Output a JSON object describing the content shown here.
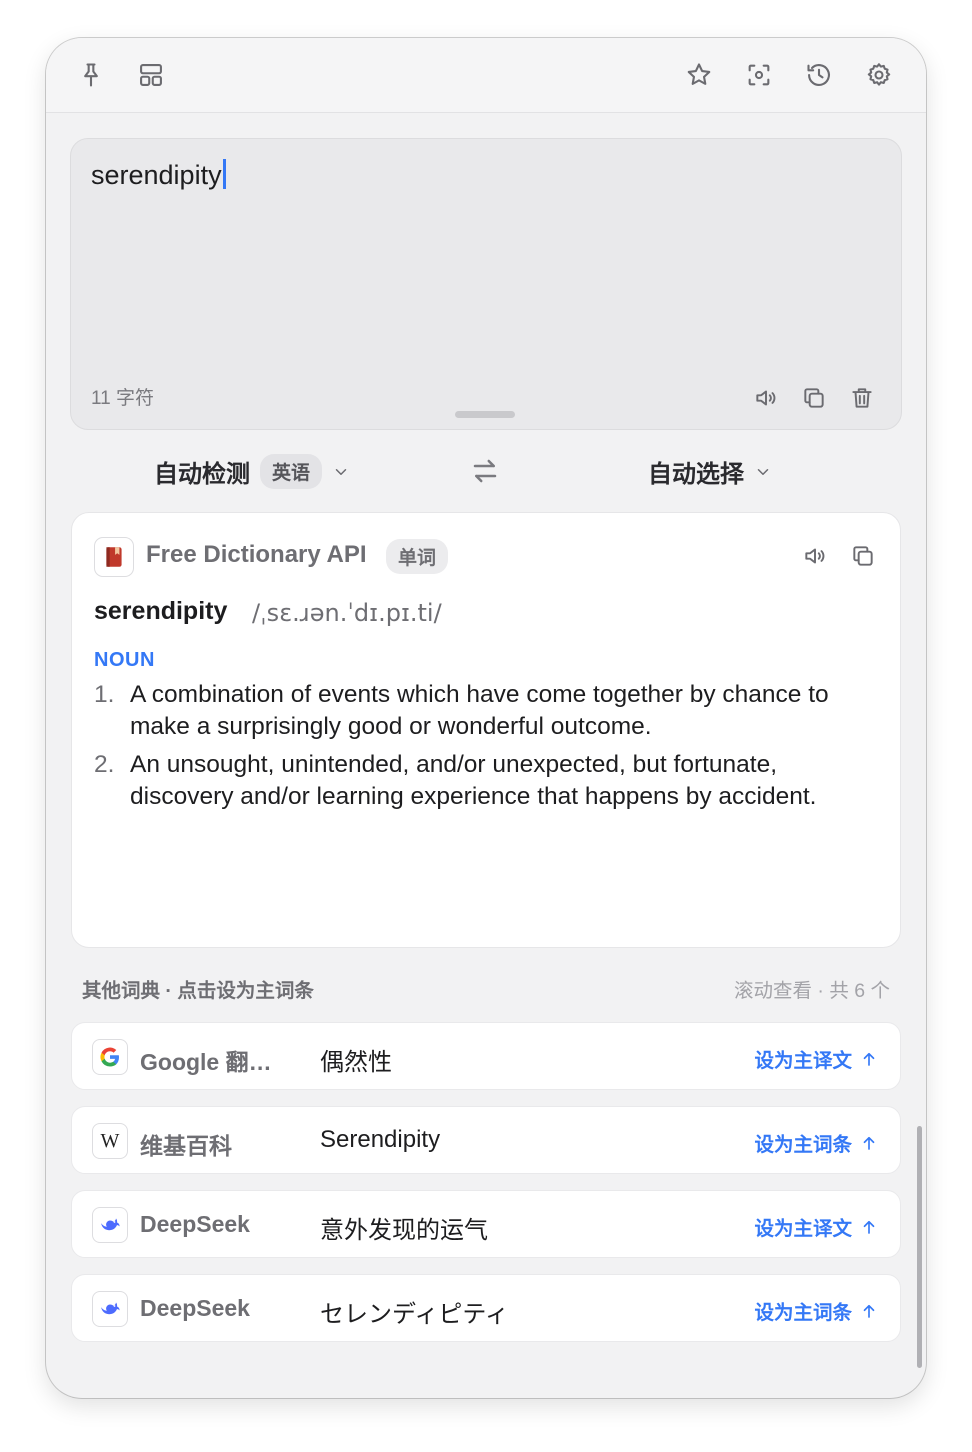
{
  "input": {
    "text": "serendipity",
    "char_count": "11 字符"
  },
  "languages": {
    "source_label": "自动检测",
    "detected": "英语",
    "target_label": "自动选择"
  },
  "main_result": {
    "source_name": "Free Dictionary API",
    "badge": "单词",
    "headword": "serendipity",
    "phonetic": "/ˌsɛ.ɹən.ˈdɪ.pɪ.ti/",
    "part_of_speech": "NOUN",
    "definitions": [
      {
        "num": "1.",
        "text": "A combination of events which have come together by chance to make a surprisingly good or wonderful outcome."
      },
      {
        "num": "2.",
        "text": "An unsought, unintended, and/or unexpected, but fortunate, discovery and/or learning experience that happens by accident."
      }
    ]
  },
  "others": {
    "heading": "其他词典 · 点击设为主词条",
    "scroll_hint": "滚动查看 · 共 6 个",
    "items": [
      {
        "name": "Google 翻…",
        "text": "偶然性",
        "action": "设为主译文"
      },
      {
        "name": "维基百科",
        "text": "Serendipity",
        "action": "设为主词条"
      },
      {
        "name": "DeepSeek",
        "text": "意外发现的运气",
        "action": "设为主译文"
      },
      {
        "name": "DeepSeek",
        "text": "セレンディピティ",
        "action": "设为主词条"
      }
    ]
  },
  "icons": {
    "pin": "pin-icon",
    "layout": "layout-icon",
    "star": "star-icon",
    "scan": "scan-icon",
    "history": "history-icon",
    "settings": "gear-icon"
  },
  "colors": {
    "accent": "#3478f6",
    "dictionary_icon": "#c0392b",
    "deepseek": "#4d6bfe"
  }
}
